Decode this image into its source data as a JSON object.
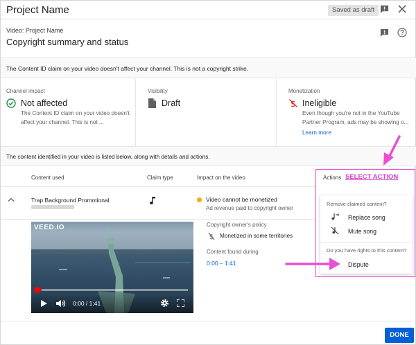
{
  "window": {
    "title": "Project Name",
    "draft_badge": "Saved as draft"
  },
  "header": {
    "video_label": "Video: Project Name",
    "title": "Copyright summary and status"
  },
  "info_notice": "The Content ID claim on your video doesn't affect your channel. This is not a copyright strike.",
  "summary": {
    "channel_impact": {
      "heading": "Channel impact",
      "value": "Not affected",
      "description": "The Content ID claim on your video doesn't affect your channel. This is not ..."
    },
    "visibility": {
      "heading": "Visibility",
      "value": "Draft"
    },
    "monetization": {
      "heading": "Monetization",
      "value": "Ineligible",
      "description": "Even though you're not in the YouTube Partner Program, ads may be showing o...",
      "link": "Learn more"
    }
  },
  "content_notice": "The content identified in your video is listed below, along with details and actions.",
  "table": {
    "headers": {
      "content": "Content used",
      "claim": "Claim type",
      "impact": "Impact on the video",
      "actions": "Actions"
    },
    "row": {
      "content_title": "Trap Background Promotional",
      "impact_main": "Video cannot be monetized",
      "impact_sub": "Ad revenue paid to copyright owner"
    }
  },
  "video": {
    "watermark": "VEED.IO",
    "time": "0:00 / 1:41",
    "progress_fraction": 0.03
  },
  "policy": {
    "heading": "Copyright owner's policy",
    "text": "Monetized in some territories",
    "found_heading": "Content found during",
    "found_range": "0:00 – 1:41"
  },
  "actions": {
    "select_label": "SELECT ACTION",
    "menu": {
      "remove_heading": "Remove claimed content?",
      "replace": "Replace song",
      "mute": "Mute song",
      "rights_heading": "Do you have rights to this content?",
      "dispute": "Dispute"
    }
  },
  "footer": {
    "done": "DONE"
  },
  "colors": {
    "accent": "#065fd4",
    "annotation": "#e84fd1",
    "status_warning": "#f9ab00",
    "success": "#1e8e3e",
    "error": "#d93025"
  }
}
